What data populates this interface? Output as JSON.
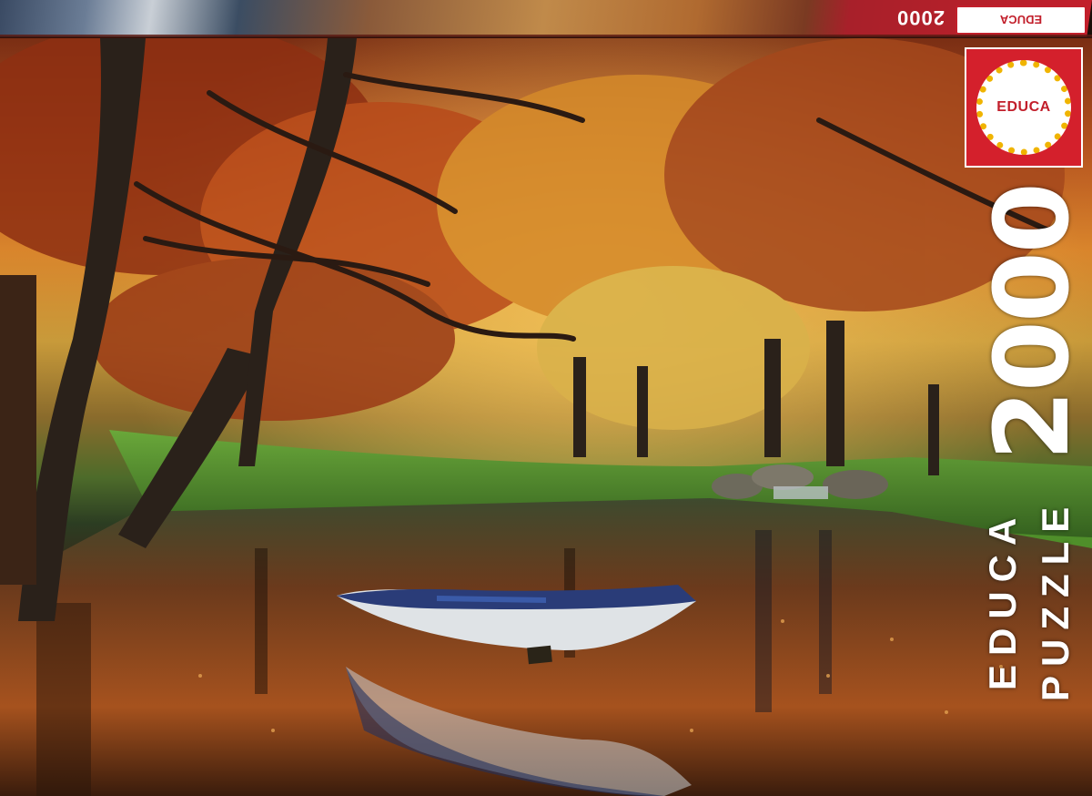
{
  "box": {
    "lid": {
      "piece_count": "2000",
      "brand": "EDUCA"
    },
    "logo": {
      "brand": "EDUCA"
    },
    "side_text": {
      "piece_count": "2000",
      "brand": "EDUCA",
      "product": "PUZZLE"
    }
  },
  "colors": {
    "brand_red": "#d4202c",
    "logo_ring": "#f0b400",
    "text": "#ffffff"
  }
}
